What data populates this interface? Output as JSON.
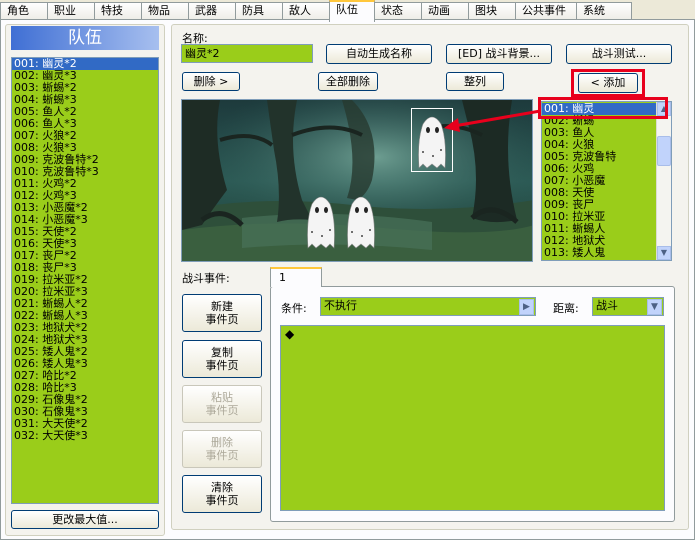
{
  "tabs": [
    {
      "label": "角色"
    },
    {
      "label": "职业"
    },
    {
      "label": "特技"
    },
    {
      "label": "物品"
    },
    {
      "label": "武器"
    },
    {
      "label": "防具"
    },
    {
      "label": "敌人"
    },
    {
      "label": "队伍"
    },
    {
      "label": "状态"
    },
    {
      "label": "动画"
    },
    {
      "label": "图块"
    },
    {
      "label": "公共事件"
    },
    {
      "label": "系统"
    }
  ],
  "troops_title": "队伍",
  "troops": [
    "001: 幽灵*2",
    "002: 幽灵*3",
    "003: 蜥蜴*2",
    "004: 蜥蜴*3",
    "005: 鱼人*2",
    "006: 鱼人*3",
    "007: 火狼*2",
    "008: 火狼*3",
    "009: 克波鲁特*2",
    "010: 克波鲁特*3",
    "011: 火鸡*2",
    "012: 火鸡*3",
    "013: 小恶魔*2",
    "014: 小恶魔*3",
    "015: 天使*2",
    "016: 天使*3",
    "017: 丧尸*2",
    "018: 丧尸*3",
    "019: 拉米亚*2",
    "020: 拉米亚*3",
    "021: 蜥蜴人*2",
    "022: 蜥蜴人*3",
    "023: 地狱犬*2",
    "024: 地狱犬*3",
    "025: 矮人鬼*2",
    "026: 矮人鬼*3",
    "027: 哈比*2",
    "028: 哈比*3",
    "029: 石像鬼*2",
    "030: 石像鬼*3",
    "031: 大天使*2",
    "032: 大天使*3"
  ],
  "change_max_label": "更改最大值...",
  "name_label": "名称:",
  "name_value": "幽灵*2",
  "auto_name_label": "自动生成名称",
  "battleback_label": "[ED] 战斗背景...",
  "battle_test_label": "战斗测试...",
  "remove_label": "删除 >",
  "clear_all_label": "全部删除",
  "arrange_label": "整列",
  "add_label": "< 添加",
  "enemies": [
    "001: 幽灵",
    "002: 蜥蜴",
    "003: 鱼人",
    "004: 火狼",
    "005: 克波鲁特",
    "006: 火鸡",
    "007: 小恶魔",
    "008: 天使",
    "009: 丧尸",
    "010: 拉米亚",
    "011: 蜥蜴人",
    "012: 地狱犬",
    "013: 矮人鬼"
  ],
  "battle_events_label": "战斗事件:",
  "page_tab": "1",
  "new_page_label": "新建\n事件页",
  "copy_page_label": "复制\n事件页",
  "paste_page_label": "粘贴\n事件页",
  "delete_page_label": "删除\n事件页",
  "clear_page_label": "清除\n事件页",
  "condition_label": "条件:",
  "condition_value": "不执行",
  "span_label": "距离:",
  "span_value": "战斗",
  "command_marker": "◆",
  "colors": {
    "list_green": "#9acd1a",
    "selection": "#316ac5",
    "highlight_red": "#e8001c",
    "title_blue": "#3f6fd4"
  }
}
